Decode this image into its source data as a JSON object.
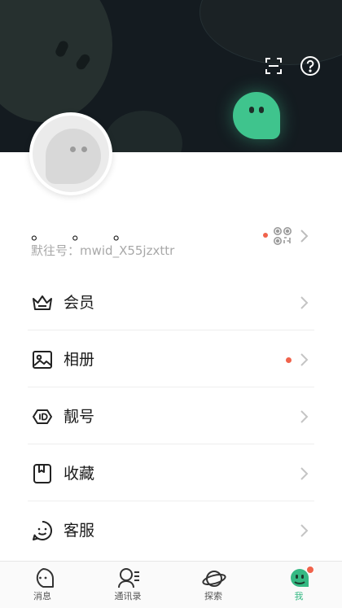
{
  "profile": {
    "name": "。 。 。",
    "id_text": "默往号：mwid_X55jzxttr"
  },
  "menu": [
    {
      "label": "会员",
      "icon": "crown-icon",
      "dot": false
    },
    {
      "label": "相册",
      "icon": "image-icon",
      "dot": true
    },
    {
      "label": "靓号",
      "icon": "id-tag-icon",
      "dot": false
    },
    {
      "label": "收藏",
      "icon": "bookmark-icon",
      "dot": false
    },
    {
      "label": "客服",
      "icon": "customer-service-icon",
      "dot": false
    }
  ],
  "tabbar": [
    {
      "label": "消息",
      "icon": "message-icon",
      "active": false
    },
    {
      "label": "通讯录",
      "icon": "contacts-icon",
      "active": false
    },
    {
      "label": "探索",
      "icon": "planet-icon",
      "active": false
    },
    {
      "label": "我",
      "icon": "me-icon",
      "active": true
    }
  ],
  "colors": {
    "accent": "#35b983",
    "badge": "#f0634c",
    "banner": "#141b20"
  }
}
